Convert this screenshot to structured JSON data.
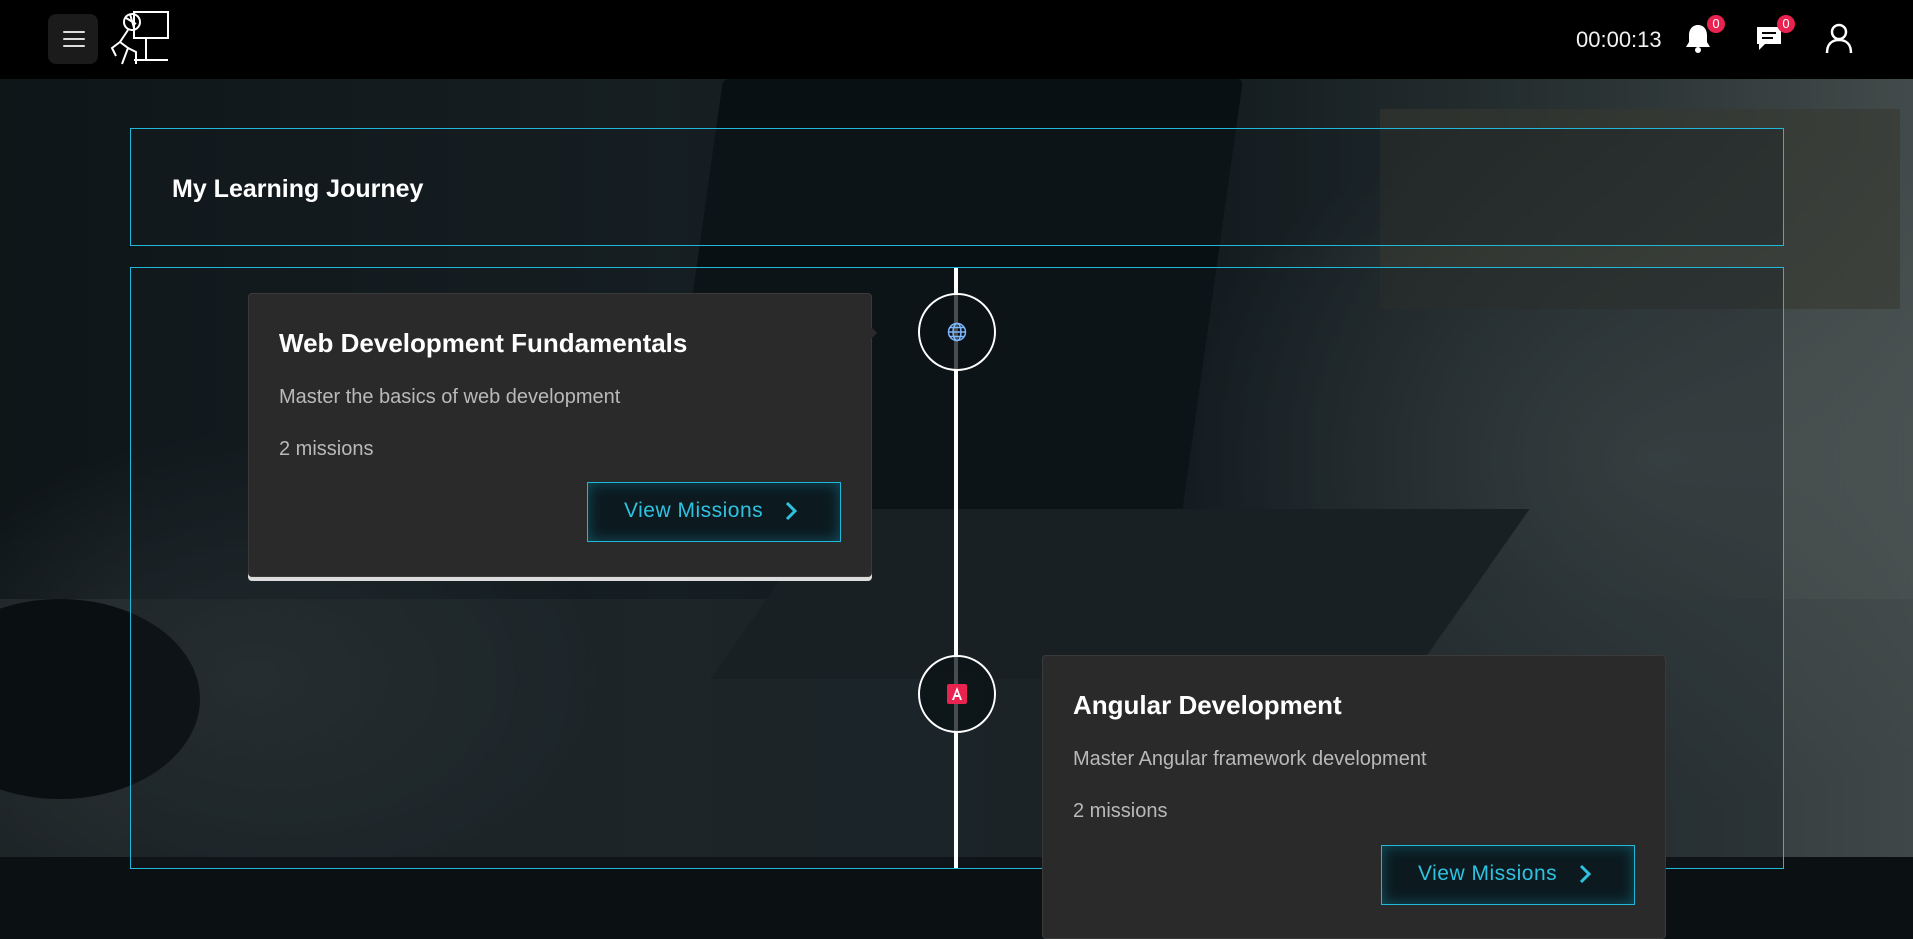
{
  "topbar": {
    "timer": "00:00:13",
    "notifications_count": "0",
    "messages_count": "0",
    "icons": [
      "menu-icon",
      "logo-icon",
      "bell-icon",
      "chat-icon",
      "user-icon"
    ]
  },
  "page": {
    "title": "My Learning Journey"
  },
  "courses": [
    {
      "title": "Web Development Fundamentals",
      "description": "Master the basics of web development",
      "missions": "2 missions",
      "button_label": "View Missions",
      "icon": "globe-icon"
    },
    {
      "title": "Angular Development",
      "description": "Master Angular framework development",
      "missions": "2 missions",
      "button_label": "View Missions",
      "icon": "angular-icon"
    }
  ],
  "colors": {
    "accent": "#1fb8d8",
    "badge": "#e8234f",
    "card_bg": "#2a2a2a",
    "topbar_bg": "#000000"
  }
}
